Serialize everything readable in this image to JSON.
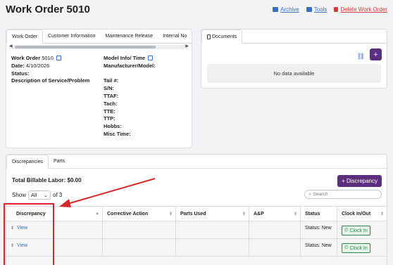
{
  "header": {
    "title": "Work Order 5010",
    "actions": [
      {
        "label": "Archive",
        "icon": "archive-icon",
        "color": "#3a6fc4"
      },
      {
        "label": "Tools",
        "icon": "toolbox-icon",
        "color": "#3a6fc4"
      },
      {
        "label": "Delete Work Order",
        "icon": "trash-icon",
        "color": "#d03b3b"
      }
    ]
  },
  "wo_panel": {
    "tabs": [
      "Work Order",
      "Customer Information",
      "Maintenance Release",
      "Internal No"
    ],
    "left": [
      {
        "label": "Work Order",
        "value": "5010"
      },
      {
        "label": "Date:",
        "value": "4/10/2026"
      },
      {
        "label": "Status:",
        "value": ""
      },
      {
        "label": "Description of Service/Problem",
        "value": ""
      }
    ],
    "right": {
      "top": [
        "Model Info/ Time",
        "Manufacturer/Model:"
      ],
      "list": [
        "Tail #:",
        "S/N:",
        "TTAF:",
        "Tach:",
        "TTE:",
        "TTP:",
        "Hobbs:",
        "Misc Time:"
      ]
    }
  },
  "documents": {
    "tab": "Documents",
    "empty": "No data available",
    "add_label": "+"
  },
  "discrepancies": {
    "tabs": [
      "Discrepancies",
      "Parts"
    ],
    "billable": "Total Billable Labor: $0.00",
    "add_button": "+ Discrepancy",
    "show_label": "Show",
    "show_value": "All",
    "of_total": "of 3",
    "search_placeholder": "Search",
    "columns": [
      "Discrepancy",
      "Corrective Action",
      "Parts Used",
      "A&P",
      "Status",
      "Clock In/Out"
    ],
    "rows": [
      {
        "view": "View",
        "status": "Status: New",
        "clock": "Clock In"
      },
      {
        "view": "View",
        "status": "Status: New",
        "clock": "Clock In"
      }
    ]
  },
  "annotation_color": "#d62828"
}
